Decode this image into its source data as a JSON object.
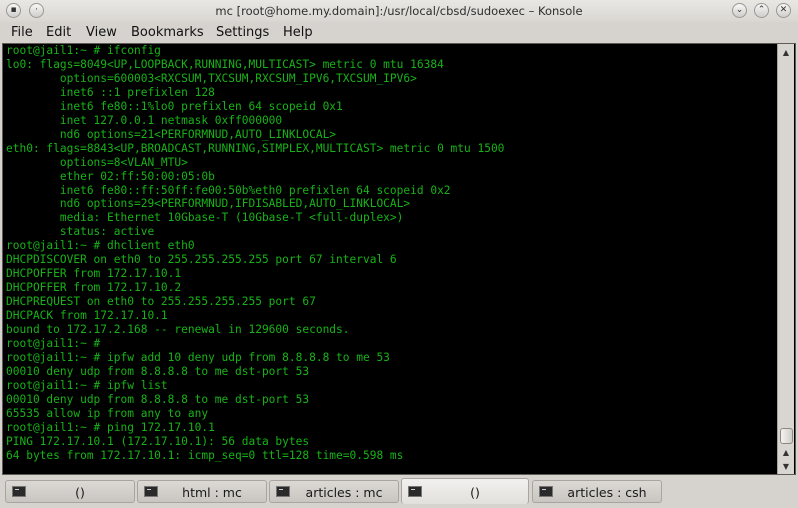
{
  "window": {
    "title": "mc [root@home.my.domain]:/usr/local/cbsd/sudoexec – Konsole"
  },
  "menubar": {
    "file": "File",
    "edit": "Edit",
    "view": "View",
    "bookmarks": "Bookmarks",
    "settings": "Settings",
    "help": "Help"
  },
  "terminal": {
    "lines": [
      "root@jail1:~ # ifconfig",
      "lo0: flags=8049<UP,LOOPBACK,RUNNING,MULTICAST> metric 0 mtu 16384",
      "        options=600003<RXCSUM,TXCSUM,RXCSUM_IPV6,TXCSUM_IPV6>",
      "        inet6 ::1 prefixlen 128",
      "        inet6 fe80::1%lo0 prefixlen 64 scopeid 0x1",
      "        inet 127.0.0.1 netmask 0xff000000",
      "        nd6 options=21<PERFORMNUD,AUTO_LINKLOCAL>",
      "eth0: flags=8843<UP,BROADCAST,RUNNING,SIMPLEX,MULTICAST> metric 0 mtu 1500",
      "        options=8<VLAN_MTU>",
      "        ether 02:ff:50:00:05:0b",
      "        inet6 fe80::ff:50ff:fe00:50b%eth0 prefixlen 64 scopeid 0x2",
      "        nd6 options=29<PERFORMNUD,IFDISABLED,AUTO_LINKLOCAL>",
      "        media: Ethernet 10Gbase-T (10Gbase-T <full-duplex>)",
      "        status: active",
      "root@jail1:~ # dhclient eth0",
      "DHCPDISCOVER on eth0 to 255.255.255.255 port 67 interval 6",
      "DHCPOFFER from 172.17.10.1",
      "DHCPOFFER from 172.17.10.2",
      "DHCPREQUEST on eth0 to 255.255.255.255 port 67",
      "DHCPACK from 172.17.10.1",
      "bound to 172.17.2.168 -- renewal in 129600 seconds.",
      "root@jail1:~ #",
      "root@jail1:~ # ipfw add 10 deny udp from 8.8.8.8 to me 53",
      "00010 deny udp from 8.8.8.8 to me dst-port 53",
      "root@jail1:~ # ipfw list",
      "00010 deny udp from 8.8.8.8 to me dst-port 53",
      "65535 allow ip from any to any",
      "root@jail1:~ # ping 172.17.10.1",
      "PING 172.17.10.1 (172.17.10.1): 56 data bytes",
      "64 bytes from 172.17.10.1: icmp_seq=0 ttl=128 time=0.598 ms"
    ],
    "text_color": "#18b218",
    "background": "#000000"
  },
  "tabs": [
    {
      "label": "()",
      "active": false
    },
    {
      "label": "html : mc",
      "active": false
    },
    {
      "label": "articles : mc",
      "active": false
    },
    {
      "label": "()",
      "active": true
    },
    {
      "label": "articles : csh",
      "active": false
    }
  ],
  "icons": {
    "menu": "menu-icon",
    "pin": "pin-icon",
    "minimize": "minimize-icon",
    "maximize": "maximize-icon",
    "close": "close-icon",
    "tab": "terminal-icon"
  }
}
